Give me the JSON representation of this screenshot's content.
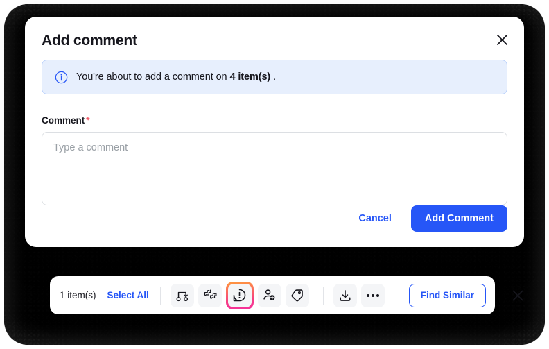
{
  "dialog": {
    "title": "Add comment",
    "close_icon": "close-icon",
    "banner": {
      "icon": "info-circle-icon",
      "text_before": "You're about to add a comment on",
      "count": "4 item(s)",
      "text_after": "."
    },
    "field": {
      "label": "Comment",
      "required_marker": "*",
      "placeholder": "Type a comment",
      "value": ""
    },
    "actions": {
      "cancel_label": "Cancel",
      "submit_label": "Add Comment"
    }
  },
  "toolbar": {
    "count_label": "1 item(s)",
    "select_all_label": "Select All",
    "icons": [
      {
        "name": "workflow-icon",
        "label": "Run workflow",
        "selected": false
      },
      {
        "name": "puzzle-connect-icon",
        "label": "Connect",
        "selected": false
      },
      {
        "name": "comment-alert-icon",
        "label": "Add comment",
        "selected": true
      },
      {
        "name": "add-person-icon",
        "label": "Assign user",
        "selected": false
      },
      {
        "name": "tag-icon",
        "label": "Add tag",
        "selected": false
      },
      {
        "name": "download-icon",
        "label": "Download",
        "selected": false
      },
      {
        "name": "more-options-icon",
        "label": "More options",
        "selected": false
      }
    ],
    "find_similar_label": "Find Similar",
    "close_icon": "close-icon"
  },
  "colors": {
    "accent_blue": "#2656f7",
    "banner_bg": "#e7effd",
    "banner_border": "#b9d0fb",
    "required_red": "#f04b5a",
    "highlight_gradient_start": "#ff9a3c",
    "highlight_gradient_end": "#f62f9b",
    "text_primary": "#16161d",
    "icon_chip_bg": "#f4f5f7"
  }
}
